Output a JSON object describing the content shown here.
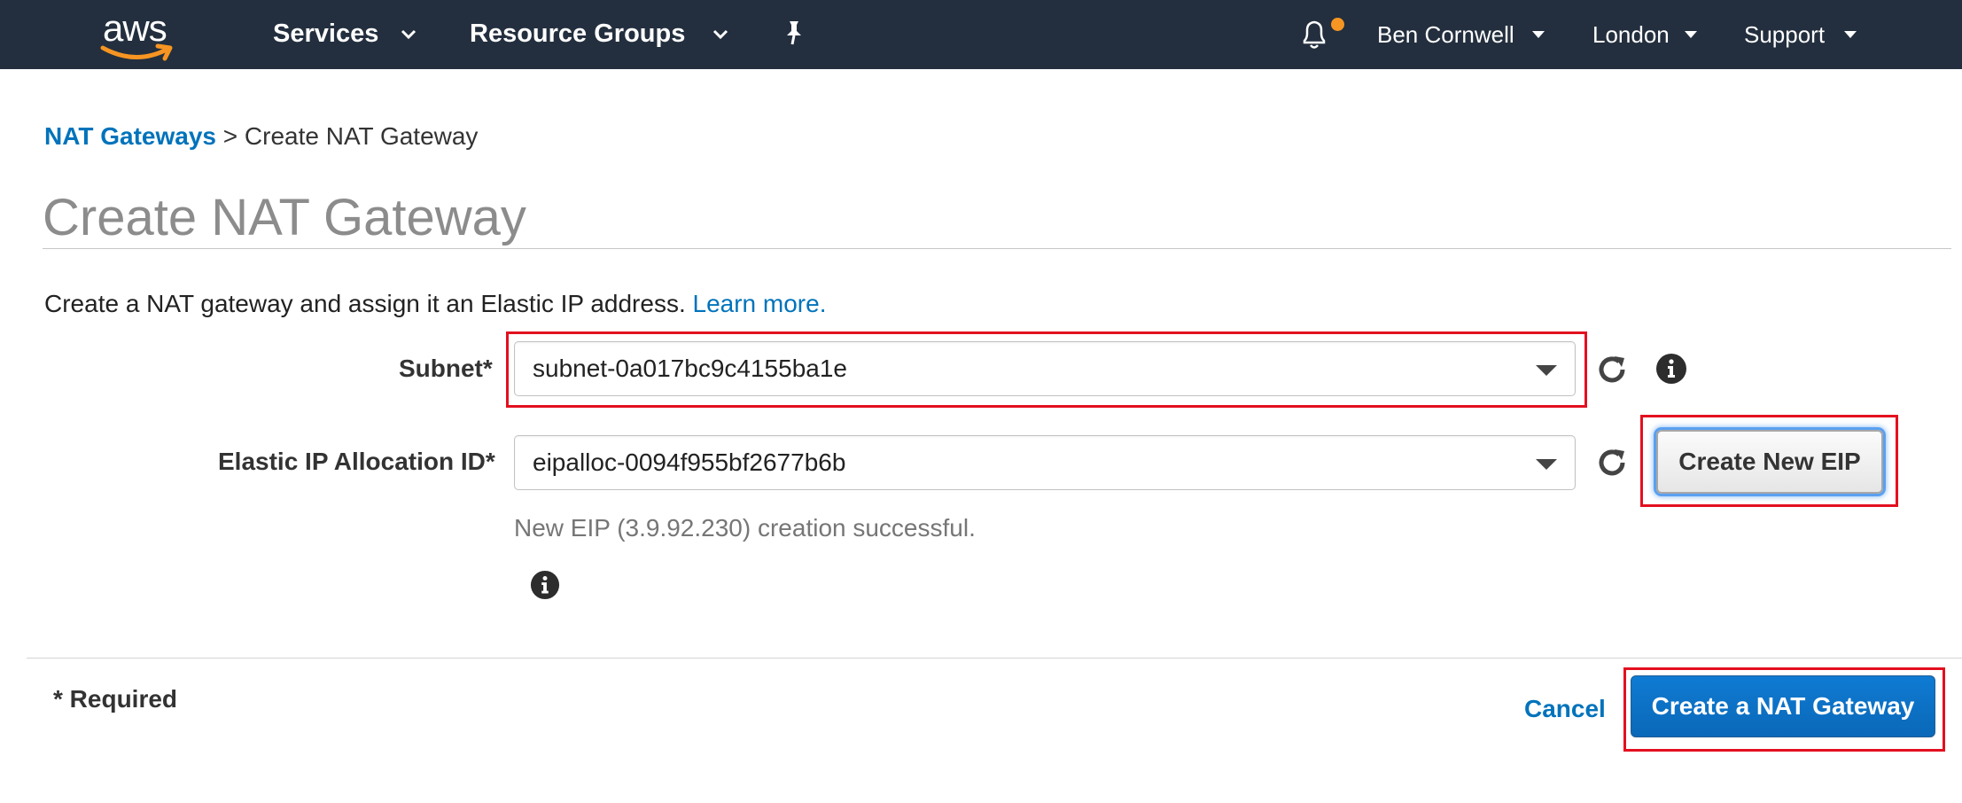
{
  "topnav": {
    "logo_text": "aws",
    "services_label": "Services",
    "resource_groups_label": "Resource Groups",
    "user_label": "Ben Cornwell",
    "region_label": "London",
    "support_label": "Support"
  },
  "breadcrumb": {
    "parent": "NAT Gateways",
    "separator": ">",
    "current": "Create NAT Gateway"
  },
  "page": {
    "title": "Create NAT Gateway",
    "intro": "Create a NAT gateway and assign it an Elastic IP address.",
    "learn_more": "Learn more."
  },
  "form": {
    "subnet_label": "Subnet*",
    "subnet_value": "subnet-0a017bc9c4155ba1e",
    "eip_label": "Elastic IP Allocation ID*",
    "eip_value": "eipalloc-0094f955bf2677b6b",
    "create_eip_label": "Create New EIP",
    "status_message": "New EIP (3.9.92.230) creation successful."
  },
  "footer": {
    "required_note": "* Required",
    "cancel_label": "Cancel",
    "submit_label": "Create a NAT Gateway"
  },
  "colors": {
    "nav_bg": "#232f3e",
    "link": "#0073bb",
    "highlight": "#e3101f",
    "primary": "#0a68b8",
    "notification_dot": "#f79522"
  }
}
